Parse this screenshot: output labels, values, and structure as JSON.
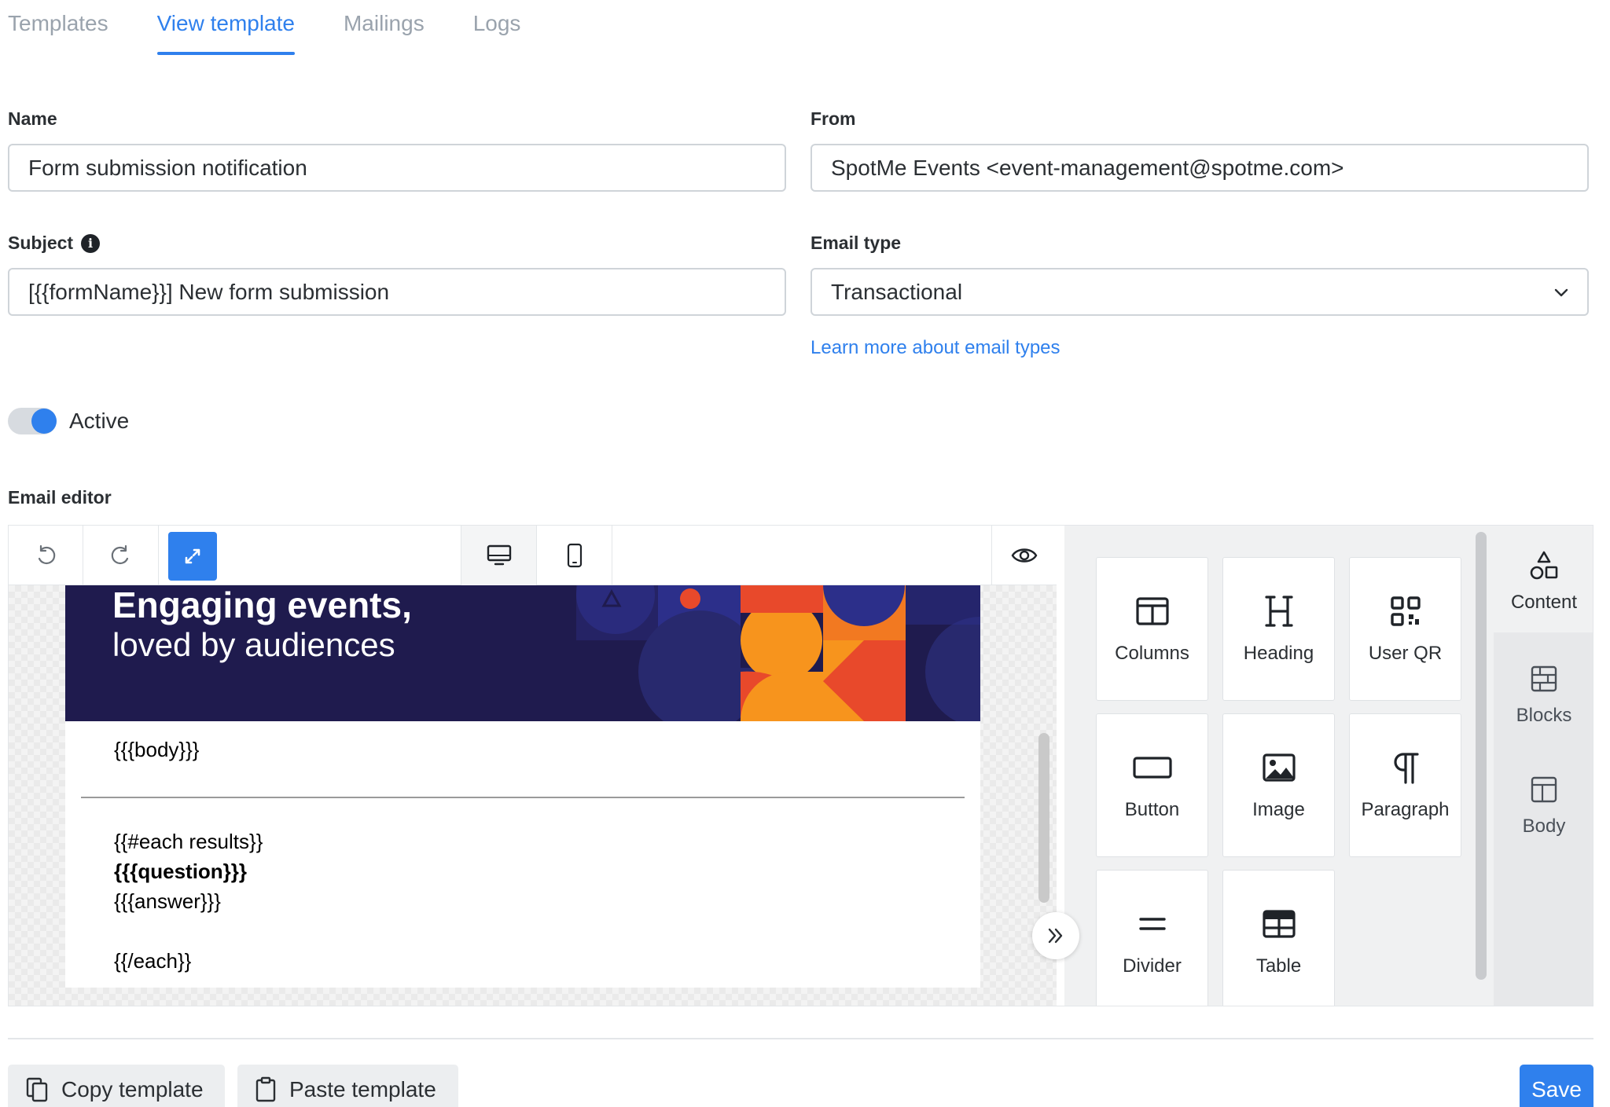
{
  "tabs": [
    {
      "label": "Templates"
    },
    {
      "label": "View template"
    },
    {
      "label": "Mailings"
    },
    {
      "label": "Logs"
    }
  ],
  "form": {
    "name_label": "Name",
    "name_value": "Form submission notification",
    "from_label": "From",
    "from_value": "SpotMe Events <event-management@spotme.com>",
    "subject_label": "Subject",
    "subject_value": "[{{formName}}] New form submission",
    "email_type_label": "Email type",
    "email_type_value": "Transactional",
    "email_type_link": "Learn more about email types",
    "active_label": "Active",
    "active_state": true,
    "editor_label": "Email editor"
  },
  "email_preview": {
    "banner_line1": "Engaging events,",
    "banner_line2": "loved by audiences",
    "body_placeholder": "{{{body}}}",
    "each_open": "{{#each results}}",
    "question": "{{{question}}}",
    "answer": "{{{answer}}}",
    "each_close": "{{/each}}"
  },
  "content_tiles": [
    {
      "label": "Columns",
      "icon": "columns-icon"
    },
    {
      "label": "Heading",
      "icon": "heading-icon"
    },
    {
      "label": "User QR",
      "icon": "qr-code-icon"
    },
    {
      "label": "Button",
      "icon": "button-icon"
    },
    {
      "label": "Image",
      "icon": "image-icon"
    },
    {
      "label": "Paragraph",
      "icon": "paragraph-icon"
    },
    {
      "label": "Divider",
      "icon": "divider-icon"
    },
    {
      "label": "Table",
      "icon": "table-icon"
    }
  ],
  "side_nav": [
    {
      "label": "Content",
      "icon": "shapes-icon"
    },
    {
      "label": "Blocks",
      "icon": "blocks-icon"
    },
    {
      "label": "Body",
      "icon": "layout-icon"
    }
  ],
  "footer": {
    "copy_label": "Copy template",
    "paste_label": "Paste template",
    "save_label": "Save"
  },
  "colors": {
    "accent": "#2f80ed",
    "banner_bg": "#1f1b4e",
    "banner_orange": "#f7941d",
    "banner_red": "#e8492b"
  }
}
